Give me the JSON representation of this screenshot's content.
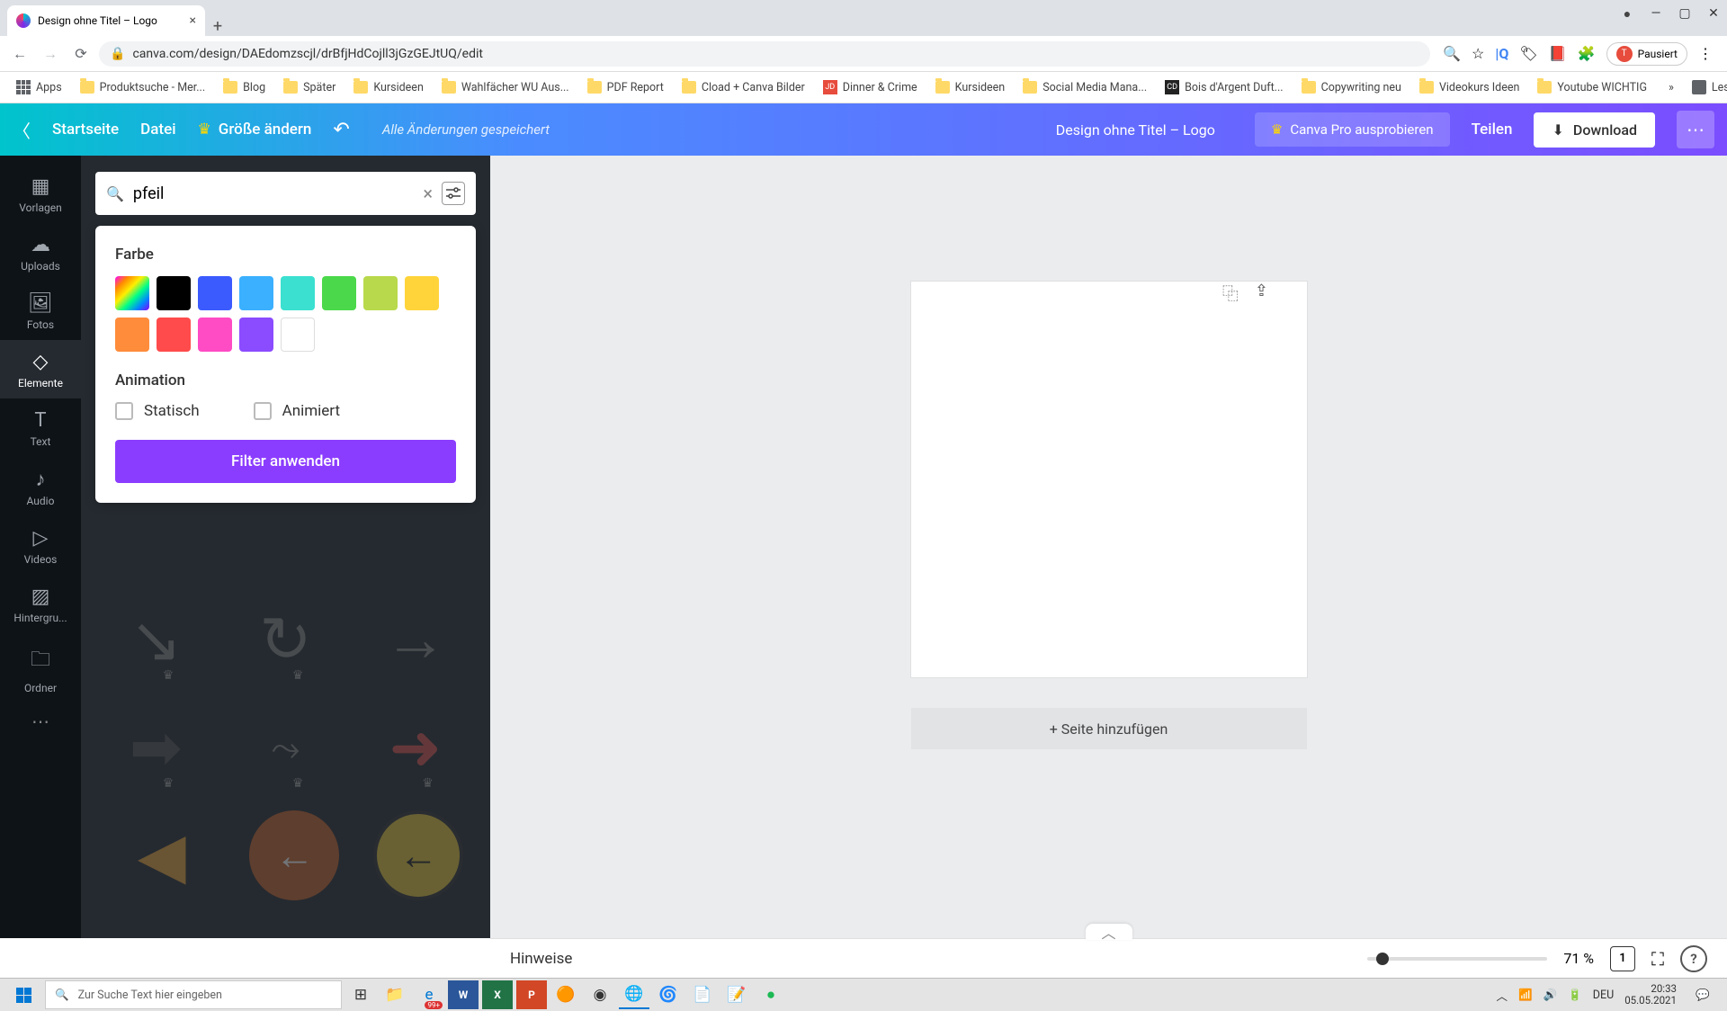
{
  "browser": {
    "tab_title": "Design ohne Titel – Logo",
    "url": "canva.com/design/DAEdomzscjl/drBfjHdCojll3jGzGEJtUQ/edit",
    "paused_label": "Pausiert",
    "avatar_letter": "T"
  },
  "bookmarks": {
    "apps": "Apps",
    "items": [
      "Produktsuche - Mer...",
      "Blog",
      "Später",
      "Kursideen",
      "Wahlfächer WU Aus...",
      "PDF Report",
      "Cload + Canva Bilder",
      "Dinner & Crime",
      "Kursideen",
      "Social Media Mana...",
      "Bois d'Argent Duft...",
      "Copywriting neu",
      "Videokurs Ideen",
      "Youtube WICHTIG"
    ],
    "reading_list": "Leseliste"
  },
  "canva_menu": {
    "home": "Startseite",
    "file": "Datei",
    "resize": "Größe ändern",
    "saved": "Alle Änderungen gespeichert",
    "doc_title": "Design ohne Titel – Logo",
    "try_pro": "Canva Pro ausprobieren",
    "share": "Teilen",
    "download": "Download"
  },
  "rail": {
    "templates": "Vorlagen",
    "uploads": "Uploads",
    "photos": "Fotos",
    "elements": "Elemente",
    "text": "Text",
    "audio": "Audio",
    "videos": "Videos",
    "background": "Hintergru...",
    "folder": "Ordner"
  },
  "search": {
    "value": "pfeil"
  },
  "filter": {
    "color_label": "Farbe",
    "animation_label": "Animation",
    "static": "Statisch",
    "animated": "Animiert",
    "apply": "Filter anwenden",
    "colors": [
      "multi",
      "#000000",
      "#3b5bff",
      "#3bb0ff",
      "#3be0d0",
      "#4bd94b",
      "#b8d94b",
      "#ffd43b",
      "#ff8c3b",
      "#ff4b4b",
      "#ff4bc4",
      "#8b4bff",
      "#ffffff"
    ]
  },
  "canvas": {
    "add_page": "+ Seite hinzufügen",
    "hints": "Hinweise",
    "zoom": "71 %",
    "page_num": "1"
  },
  "taskbar": {
    "search_placeholder": "Zur Suche Text hier eingeben",
    "lang": "DEU",
    "time": "20:33",
    "date": "05.05.2021"
  }
}
